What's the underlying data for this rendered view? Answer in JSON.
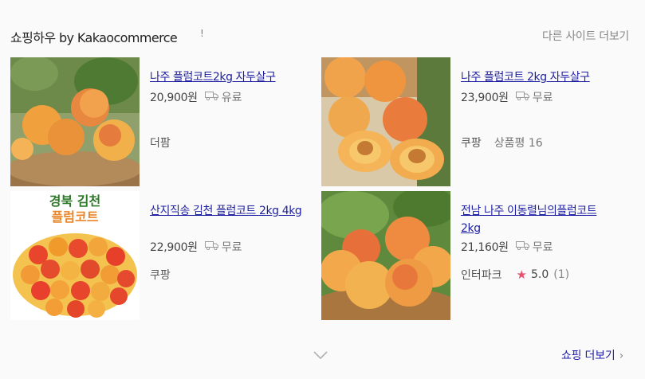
{
  "header": {
    "title": "쇼핑하우 by Kakaocommerce",
    "info_icon": "!",
    "more_sites": "다른 사이트 더보기"
  },
  "products": [
    {
      "name": "나주 플럼코트2kg 자두살구",
      "price": "20,900원",
      "shipping": "유료",
      "seller": "더팜"
    },
    {
      "name": "나주 플럼코트 2kg 자두살구",
      "price": "23,900원",
      "shipping": "무료",
      "seller": "쿠팡",
      "review_label": "상품평 16"
    },
    {
      "name": "산지직송 김천 플럼코트 2kg 4kg",
      "price": "22,900원",
      "shipping": "무료",
      "seller": "쿠팡",
      "image_text_top": "경북 김천",
      "image_text_bottom": "플럼코트"
    },
    {
      "name": "전남 나주 이동렬님의플럼코트2kg",
      "price": "21,160원",
      "shipping": "무료",
      "seller": "인터파크",
      "rating": "5.0",
      "rating_count": "(1)"
    }
  ],
  "footer": {
    "shop_more": "쇼핑 더보기",
    "arrow": "›"
  },
  "icons": {
    "truck": "truck-icon",
    "star": "star-icon",
    "chevron": "chevron-down-icon"
  },
  "colors": {
    "link": "#1d1fa3",
    "star": "#e7516e",
    "background": "#fbfafb"
  }
}
